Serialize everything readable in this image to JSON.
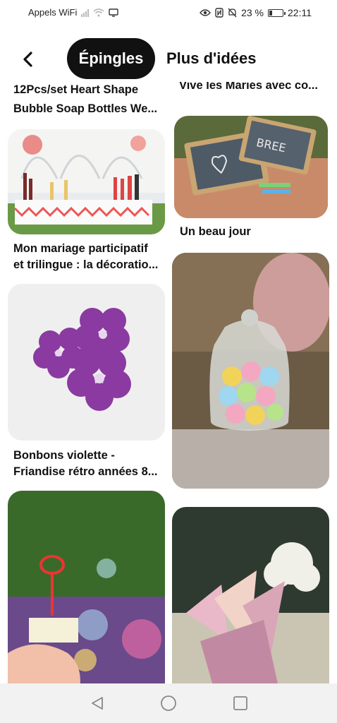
{
  "status_bar": {
    "carrier": "Appels WiFi",
    "battery_percent": "23 %",
    "battery_level": 0.23,
    "time": "22:11"
  },
  "header": {
    "tabs": [
      {
        "label": "Épingles",
        "active": true
      },
      {
        "label": "Plus d'idées",
        "active": false
      }
    ]
  },
  "pins": [
    {
      "title": "12Pcs/set Heart Shape Bubble Soap Bottles We...",
      "line1": "12Pcs/set Heart Shape",
      "line2": "Bubble Soap Bottles We..."
    },
    {
      "title": "Vive les Mariés avec co...",
      "line1": "Vive les Mariés avec co..."
    },
    {
      "title": "Mon mariage participatif et trilingue : la décoratio...",
      "line1": "Mon mariage participatif",
      "line2": "et trilingue : la décoratio..."
    },
    {
      "title": "Un beau jour",
      "line1": "Un beau jour"
    },
    {
      "title": "Bonbons violette - Friandise rétro années 8...",
      "line1": "Bonbons violette -",
      "line2": "Friandise rétro années 8..."
    }
  ],
  "colors": {
    "accent": "#111111",
    "background": "#ffffff",
    "nav_bar": "#f2f2f2"
  }
}
